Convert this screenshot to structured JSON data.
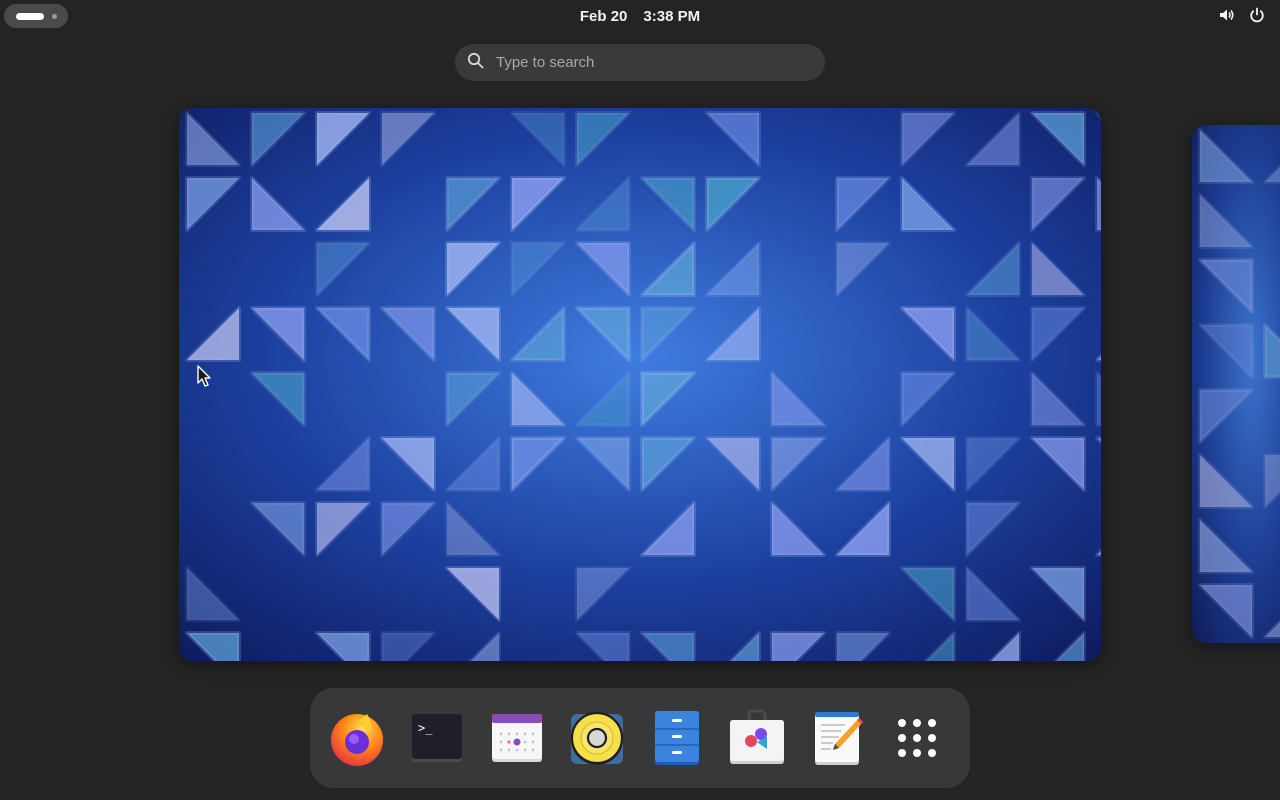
{
  "topbar": {
    "date": "Feb 20",
    "time": "3:38 PM",
    "icons": [
      "activities-indicator",
      "volume-icon",
      "power-icon"
    ]
  },
  "search": {
    "placeholder": "Type to search",
    "value": ""
  },
  "workspaces": {
    "wallpaper": "blue-triangles",
    "count_visible": 2
  },
  "dash": {
    "apps": [
      {
        "name": "Firefox",
        "icon": "firefox-icon"
      },
      {
        "name": "Terminal",
        "icon": "terminal-icon"
      },
      {
        "name": "Calendar",
        "icon": "calendar-icon"
      },
      {
        "name": "Rhythmbox",
        "icon": "rhythmbox-icon"
      },
      {
        "name": "Files",
        "icon": "files-icon"
      },
      {
        "name": "Software",
        "icon": "software-icon"
      },
      {
        "name": "Text Editor",
        "icon": "text-editor-icon"
      },
      {
        "name": "Show Apps",
        "icon": "app-grid-icon"
      }
    ]
  },
  "colors": {
    "background": "#242424",
    "dash": "#383838",
    "search": "#3a3a3a",
    "wallpaper_base": "#1c3f9e"
  }
}
